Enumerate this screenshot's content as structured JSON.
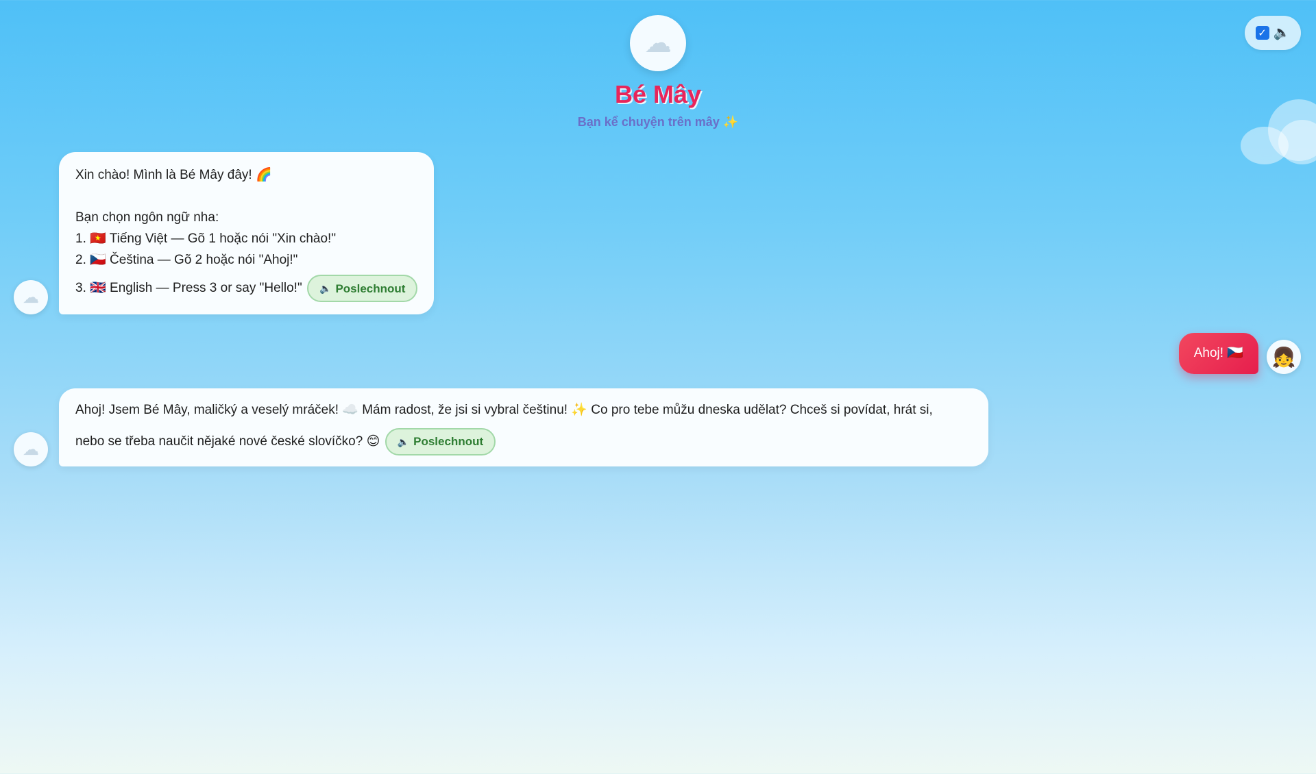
{
  "header": {
    "logo_icon": "☁",
    "title": "Bé Mây",
    "subtitle": "Bạn kể chuyện trên mây",
    "subtitle_icon": "✨"
  },
  "sound_toggle": {
    "checked": true,
    "checkbox_icon": "✓",
    "speaker_icon": "🔈"
  },
  "messages": [
    {
      "role": "bot",
      "avatar_icon": "☁",
      "lines": [
        "Xin chào! Mình là Bé Mây đây! 🌈",
        "Bạn chọn ngôn ngữ nha:",
        "1. 🇻🇳 Tiếng Việt — Gõ 1 hoặc nói \"Xin chào!\"",
        "2. 🇨🇿 Čeština — Gõ 2 hoặc nói \"Ahoj!\"",
        "3. 🇬🇧 English — Press 3 or say \"Hello!\""
      ],
      "listen_icon": "🔈",
      "listen_label": "Poslechnout"
    },
    {
      "role": "user",
      "avatar_icon": "👧",
      "text": "Ahoj! 🇨🇿"
    },
    {
      "role": "bot",
      "avatar_icon": "☁",
      "lines": [
        "Ahoj! Jsem Bé Mây, maličký a veselý mráček! ☁️ Mám radost, že jsi si vybral češtinu! ✨ Co pro tebe můžu dneska udělat? Chceš si povídat, hrát si,",
        "nebo se třeba naučit nějaké nové české slovíčko? 😊"
      ],
      "listen_icon": "🔈",
      "listen_label": "Poslechnout"
    }
  ],
  "colors": {
    "title": "#e8255a",
    "subtitle": "#6a6fc8",
    "user_bubble": "#e61e4d",
    "listen_button_text": "#2e7d32",
    "listen_button_bg": "#ddf3dc"
  }
}
